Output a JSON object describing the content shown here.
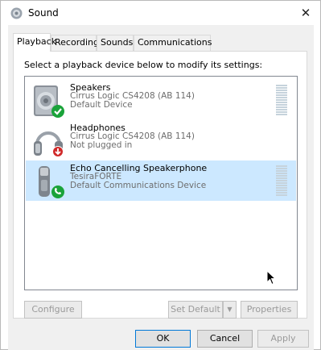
{
  "window": {
    "title": "Sound",
    "icon": "speaker-icon",
    "close_glyph": "✕"
  },
  "tabs": [
    {
      "label": "Playback",
      "active": true
    },
    {
      "label": "Recording",
      "active": false
    },
    {
      "label": "Sounds",
      "active": false
    },
    {
      "label": "Communications",
      "active": false
    }
  ],
  "playback": {
    "instruction": "Select a playback device below to modify its settings:",
    "devices": [
      {
        "name": "Speakers",
        "driver": "Cirrus Logic CS4208 (AB 114)",
        "status": "Default Device",
        "icon": "speakers-icon",
        "badge": "green-check-icon",
        "selected": false
      },
      {
        "name": "Headphones",
        "driver": "Cirrus Logic CS4208 (AB 114)",
        "status": "Not plugged in",
        "icon": "headphones-icon",
        "badge": "red-down-arrow-icon",
        "selected": false
      },
      {
        "name": "Echo Cancelling Speakerphone",
        "driver": "TesiraFORTE",
        "status": "Default Communications Device",
        "icon": "speakerphone-icon",
        "badge": "green-phone-icon",
        "selected": true
      }
    ],
    "buttons": {
      "configure": "Configure",
      "set_default": "Set Default",
      "set_default_arrow": "▼",
      "properties": "Properties"
    }
  },
  "dialog_buttons": {
    "ok": "OK",
    "cancel": "Cancel",
    "apply": "Apply"
  },
  "colors": {
    "selection": "#cce8ff",
    "badge_green": "#1aa33a",
    "badge_red": "#d02a2a",
    "accent_border": "#0078d7"
  }
}
